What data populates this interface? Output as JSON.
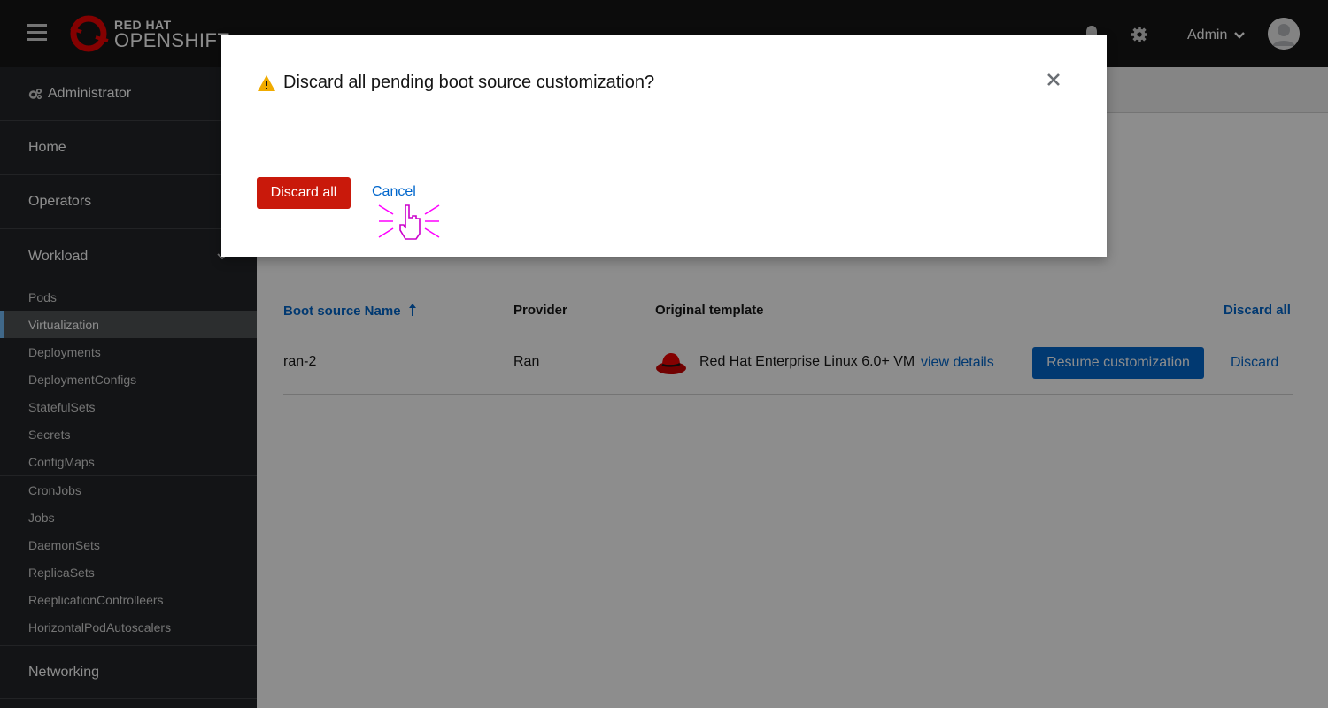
{
  "masthead": {
    "logo_line1": "RED HAT",
    "logo_line2": "OPENSHIFT",
    "user_name": "Admin"
  },
  "sidebar": {
    "perspective": "Administrator",
    "home": "Home",
    "operators": "Operators",
    "workload": {
      "label": "Workload",
      "items": [
        {
          "label": "Pods"
        },
        {
          "label": "Virtualization",
          "active": true
        },
        {
          "label": "Deployments"
        },
        {
          "label": "DeploymentConfigs"
        },
        {
          "label": "StatefulSets"
        },
        {
          "label": "Secrets"
        },
        {
          "label": "ConfigMaps"
        },
        {
          "label": "CronJobs"
        },
        {
          "label": "Jobs"
        },
        {
          "label": "DaemonSets"
        },
        {
          "label": "ReplicaSets"
        },
        {
          "label": "ReeplicationControlleers"
        },
        {
          "label": "HorizontalPodAutoscalers"
        }
      ]
    },
    "networking": "Networking"
  },
  "table": {
    "headers": {
      "name": "Boot source Name",
      "provider": "Provider",
      "template": "Original template",
      "discard_all": "Discard all"
    },
    "rows": [
      {
        "name": "ran-2",
        "provider": "Ran",
        "template": "Red Hat Enterprise Linux 6.0+ VM",
        "view_details": "view details",
        "resume": "Resume customization",
        "discard": "Discard"
      }
    ]
  },
  "modal": {
    "title": "Discard all pending boot source customization?",
    "confirm_label": "Discard all",
    "cancel_label": "Cancel"
  },
  "colors": {
    "masthead": "#151515",
    "sidebar": "#212427",
    "link": "#0066cc",
    "danger": "#c9190b",
    "primary": "#0066cc",
    "warning": "#f0ab00"
  },
  "icons": [
    "hamburger-icon",
    "redhat-logo-icon",
    "bell-icon",
    "gear-icon",
    "chevron-down-icon",
    "avatar-icon",
    "cogs-icon",
    "sort-up-icon",
    "redhat-hat-icon",
    "warning-icon",
    "close-icon",
    "pointer-cursor-icon"
  ]
}
